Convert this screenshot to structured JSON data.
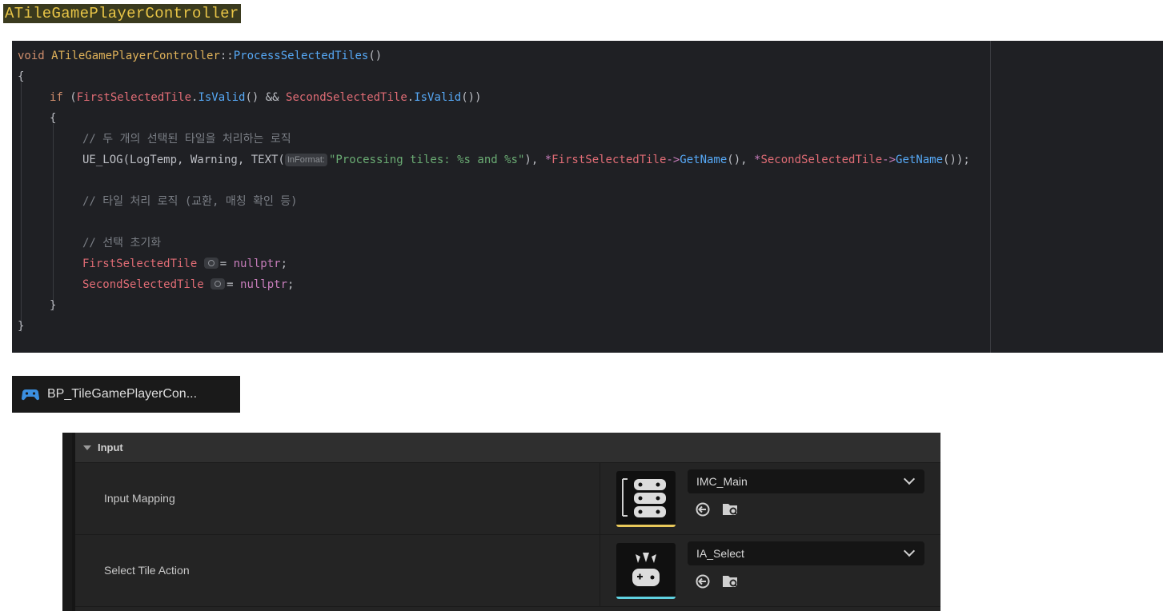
{
  "header": {
    "class_name": "ATileGamePlayerController"
  },
  "code": {
    "line1_void": "void",
    "line1_class": "ATileGamePlayerController",
    "line1_sep": "::",
    "line1_func": "ProcessSelectedTiles",
    "line1_parens": "()",
    "line2": "{",
    "line3_if": "if",
    "line3_open": " (",
    "line3_var1": "FirstSelectedTile",
    "line3_dot1": ".",
    "line3_call1": "IsValid",
    "line3_mid": "() && ",
    "line3_var2": "SecondSelectedTile",
    "line3_dot2": ".",
    "line3_call2": "IsValid",
    "line3_close": "())",
    "line4": "{",
    "line5_comment": "// 두 개의 선택된 타일을 처리하는 로직",
    "line6_prefix": "UE_LOG(LogTemp, Warning, TEXT(",
    "line6_hint": "InFormat:",
    "line6_string": "\"Processing tiles: %s and %s\"",
    "line6_mid": "), ",
    "line6_star1": "*",
    "line6_var1": "FirstSelectedTile",
    "line6_arrow1": "->",
    "line6_call1": "GetName",
    "line6_sep": "(), ",
    "line6_star2": "*",
    "line6_var2": "SecondSelectedTile",
    "line6_arrow2": "->",
    "line6_call2": "GetName",
    "line6_end": "());",
    "line8_comment": "// 타일 처리 로직 (교환, 매칭 확인 등)",
    "line10_comment": "// 선택 초기화",
    "line11_var": "FirstSelectedTile",
    "line11_eq": "= ",
    "line11_null": "nullptr",
    "line11_end": ";",
    "line12_var": "SecondSelectedTile",
    "line12_eq": "= ",
    "line12_null": "nullptr",
    "line12_end": ";",
    "line13": "}",
    "line14": "}"
  },
  "blueprint_tab": {
    "icon": "gamepad-icon",
    "label": "BP_TileGamePlayerCon..."
  },
  "details": {
    "section_title": "Input",
    "rows": [
      {
        "name": "Input Mapping",
        "value": "IMC_Main",
        "thumbnail_icon": "input-mapping-context-icon",
        "accent": "#e8c85a"
      },
      {
        "name": "Select Tile Action",
        "value": "IA_Select",
        "thumbnail_icon": "input-action-icon",
        "accent": "#5fd1e0"
      }
    ]
  },
  "colors": {
    "editor_bg": "#1f2024",
    "panel_bg": "#242424",
    "keyword": "#cf8e6d",
    "function": "#56a8f5",
    "member": "#e06c75",
    "string": "#6aab73",
    "comment": "#7a7e85"
  }
}
